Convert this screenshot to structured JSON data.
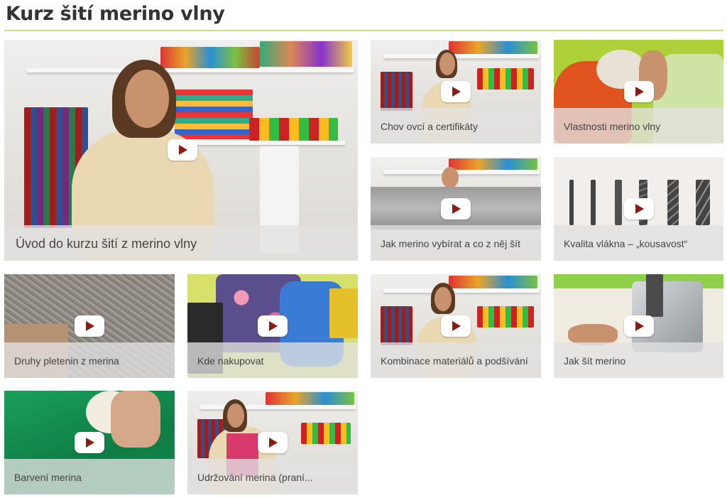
{
  "page": {
    "title": "Kurz šití merino vlny"
  },
  "videos": [
    {
      "label": "Úvod do kurzu šití z merino vlny",
      "scene": "studio-presenter",
      "featured": true
    },
    {
      "label": "Chov ovcí a certifikáty",
      "scene": "studio-presenter"
    },
    {
      "label": "Vlastnosti merino vlny",
      "scene": "fabric-hands"
    },
    {
      "label": "Jak merino vybírat a co z něj šít",
      "scene": "fabric-held"
    },
    {
      "label": "Kvalita vlákna – „kousavost“",
      "scene": "fiber-diagram"
    },
    {
      "label": "Druhy pletenin z merina",
      "scene": "knit-closeup"
    },
    {
      "label": "Kde nakupovat",
      "scene": "fabric-pile"
    },
    {
      "label": "Kombinace materiálů a podšívání",
      "scene": "studio-presenter"
    },
    {
      "label": "Jak šít merino",
      "scene": "sewing-machine"
    },
    {
      "label": "Barvení merina",
      "scene": "dyed-fabric"
    },
    {
      "label": "Udržování merina (praní...",
      "scene": "studio-presenter"
    }
  ],
  "colors": {
    "accent_rule": "#c8dc8a",
    "play_icon": "#8b1a10",
    "caption_band": "#e1e1e1"
  },
  "icons": {
    "play": "play-button-icon"
  }
}
